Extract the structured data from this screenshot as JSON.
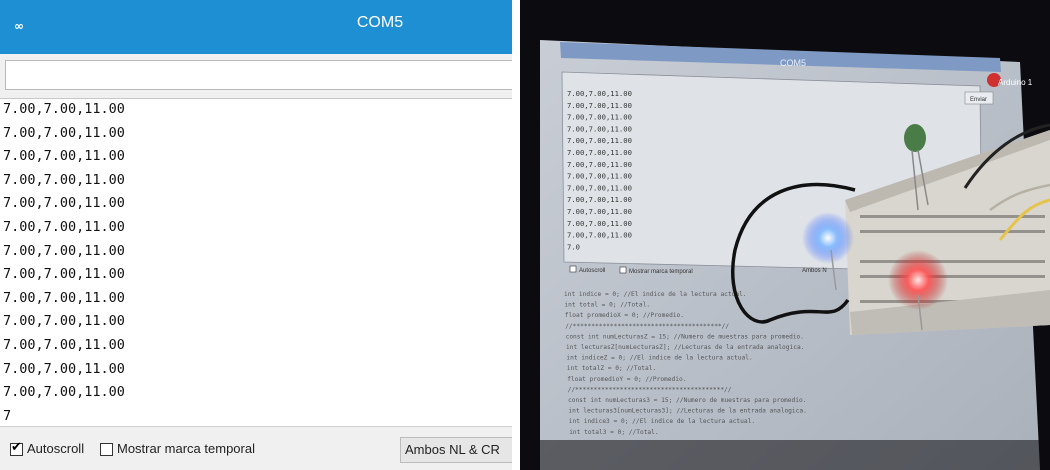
{
  "window": {
    "title": "COM5"
  },
  "send_input": {
    "value": ""
  },
  "output": {
    "lines": [
      "7.00,7.00,11.00",
      "7.00,7.00,11.00",
      "7.00,7.00,11.00",
      "7.00,7.00,11.00",
      "7.00,7.00,11.00",
      "7.00,7.00,11.00",
      "7.00,7.00,11.00",
      "7.00,7.00,11.00",
      "7.00,7.00,11.00",
      "7.00,7.00,11.00",
      "7.00,7.00,11.00",
      "7.00,7.00,11.00",
      "7.00,7.00,11.00",
      "7"
    ]
  },
  "footer": {
    "autoscroll_label": "Autoscroll",
    "autoscroll_checked": true,
    "timestamp_label": "Mostrar marca temporal",
    "timestamp_checked": false,
    "line_ending": "Ambos NL & CR"
  },
  "photo": {
    "title": "COM5",
    "send_label": "Enviar",
    "lines": [
      "7.00,7.00,11.00",
      "7.00,7.00,11.00",
      "7.00,7.00,11.00",
      "7.00,7.00,11.00",
      "7.00,7.00,11.00",
      "7.00,7.00,11.00",
      "7.00,7.00,11.00",
      "7.00,7.00,11.00",
      "7.00,7.00,11.00",
      "7.00,7.00,11.00",
      "7.00,7.00,11.00",
      "7.00,7.00,11.00",
      "7.00,7.00,11.00",
      "7.0"
    ],
    "autoscroll_label": "Autoscroll",
    "timestamp_label": "Mostrar marca temporal",
    "line_ending": "Ambos N",
    "code_lines": [
      "int indice = 0; //El indice de la lectura actual.",
      "int total = 0; //Total.",
      "float promedioX = 0; //Promedio.",
      "//****************************************//",
      "const int numLecturasZ = 15; //Numero de muestras para promedio.",
      "int lecturasZ[numLecturasZ]; //Lecturas de la entrada analogica.",
      "int indiceZ = 0; //El indice de la lectura actual.",
      "int totalZ = 0; //Total.",
      "float promedioY = 0; //Promedio.",
      "//****************************************//",
      "const int numLecturas3 = 15; //Numero de muestras para promedio.",
      "int lecturas3[numLecturas3]; //Lecturas de la entrada analogica.",
      "int indice3 = 0; //El indice de la lectura actual.",
      "int total3 = 0; //Total."
    ],
    "arduino_label": "Arduino 1"
  }
}
